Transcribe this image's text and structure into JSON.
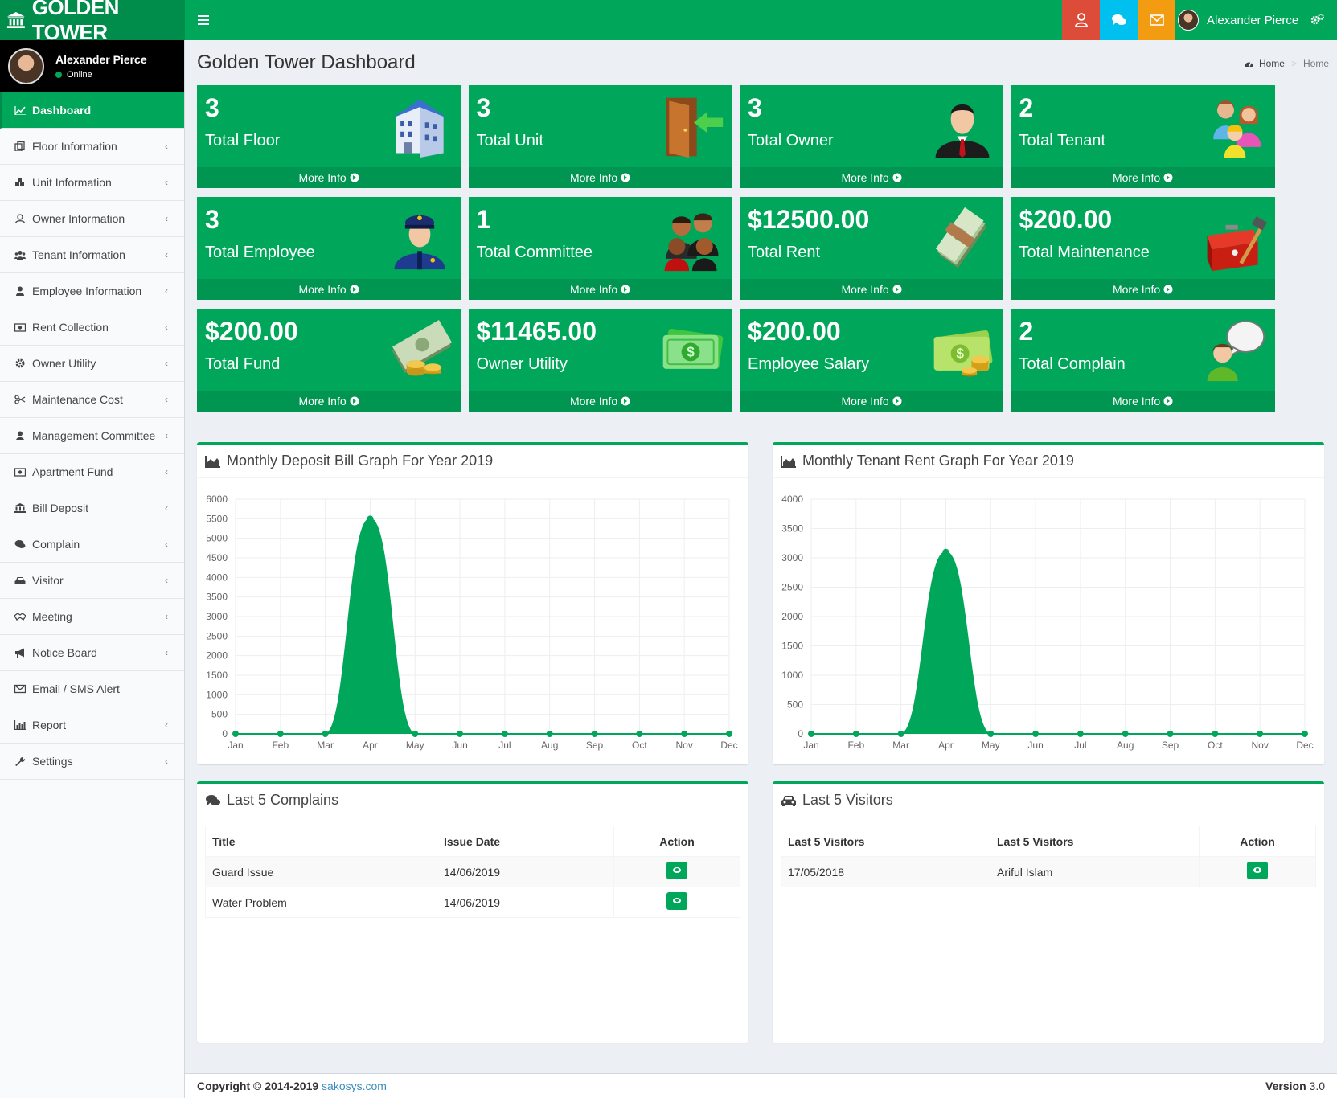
{
  "app": {
    "logo_text": "GOLDEN TOWER"
  },
  "header": {
    "user_name": "Alexander Pierce",
    "colors": {
      "alert": "#dd4b39",
      "chat": "#00c0ef",
      "mail": "#f39c12"
    }
  },
  "sidebar": {
    "user": {
      "name": "Alexander Pierce",
      "status": "Online"
    },
    "items": [
      {
        "label": "Dashboard",
        "icon": "line-chart-icon"
      },
      {
        "label": "Floor Information",
        "icon": "copy-icon"
      },
      {
        "label": "Unit Information",
        "icon": "cubes-icon"
      },
      {
        "label": "Owner Information",
        "icon": "user-outline-icon"
      },
      {
        "label": "Tenant Information",
        "icon": "users-icon"
      },
      {
        "label": "Employee Information",
        "icon": "user-icon"
      },
      {
        "label": "Rent Collection",
        "icon": "money-icon"
      },
      {
        "label": "Owner Utility",
        "icon": "gear-icon"
      },
      {
        "label": "Maintenance Cost",
        "icon": "scissors-icon"
      },
      {
        "label": "Management Committee",
        "icon": "user-icon"
      },
      {
        "label": "Apartment Fund",
        "icon": "money-icon"
      },
      {
        "label": "Bill Deposit",
        "icon": "bank-icon"
      },
      {
        "label": "Complain",
        "icon": "comments-icon"
      },
      {
        "label": "Visitor",
        "icon": "car-icon"
      },
      {
        "label": "Meeting",
        "icon": "handshake-icon"
      },
      {
        "label": "Notice Board",
        "icon": "bullhorn-icon"
      },
      {
        "label": "Email / SMS Alert",
        "icon": "envelope-icon"
      },
      {
        "label": "Report",
        "icon": "bar-chart-icon"
      },
      {
        "label": "Settings",
        "icon": "wrench-icon"
      }
    ]
  },
  "page": {
    "title": "Golden Tower Dashboard",
    "breadcrumb": {
      "home": "Home",
      "current": "Home"
    }
  },
  "boxes": [
    {
      "value": "3",
      "label": "Total Floor",
      "more": "More Info",
      "icon": "building-icon"
    },
    {
      "value": "3",
      "label": "Total Unit",
      "more": "More Info",
      "icon": "door-icon"
    },
    {
      "value": "3",
      "label": "Total Owner",
      "more": "More Info",
      "icon": "businessman-icon"
    },
    {
      "value": "2",
      "label": "Total Tenant",
      "more": "More Info",
      "icon": "family-icon"
    },
    {
      "value": "3",
      "label": "Total Employee",
      "more": "More Info",
      "icon": "officer-icon"
    },
    {
      "value": "1",
      "label": "Total Committee",
      "more": "More Info",
      "icon": "group-icon"
    },
    {
      "value": "$12500.00",
      "label": "Total Rent",
      "more": "More Info",
      "icon": "cash-stack-icon"
    },
    {
      "value": "$200.00",
      "label": "Total Maintenance",
      "more": "More Info",
      "icon": "toolbox-icon"
    },
    {
      "value": "$200.00",
      "label": "Total Fund",
      "more": "More Info",
      "icon": "cash-coins-icon"
    },
    {
      "value": "$11465.00",
      "label": "Owner Utility",
      "more": "More Info",
      "icon": "banknote-icon"
    },
    {
      "value": "$200.00",
      "label": "Employee Salary",
      "more": "More Info",
      "icon": "banknote-coins-icon"
    },
    {
      "value": "2",
      "label": "Total Complain",
      "more": "More Info",
      "icon": "speech-person-icon"
    }
  ],
  "chart_data": [
    {
      "type": "area",
      "title": "Monthly Deposit Bill Graph For Year 2019",
      "categories": [
        "Jan",
        "Feb",
        "Mar",
        "Apr",
        "May",
        "Jun",
        "Jul",
        "Aug",
        "Sep",
        "Oct",
        "Nov",
        "Dec"
      ],
      "values": [
        0,
        0,
        0,
        5500,
        0,
        0,
        0,
        0,
        0,
        0,
        0,
        0
      ],
      "ylim": [
        0,
        6000
      ],
      "yticks": [
        0,
        500,
        1000,
        1500,
        2000,
        2500,
        3000,
        3500,
        4000,
        4500,
        5000,
        5500,
        6000
      ],
      "grid": true,
      "color": "#00a65a"
    },
    {
      "type": "area",
      "title": "Monthly Tenant Rent Graph For Year 2019",
      "categories": [
        "Jan",
        "Feb",
        "Mar",
        "Apr",
        "May",
        "Jun",
        "Jul",
        "Aug",
        "Sep",
        "Oct",
        "Nov",
        "Dec"
      ],
      "values": [
        0,
        0,
        0,
        3100,
        0,
        0,
        0,
        0,
        0,
        0,
        0,
        0
      ],
      "ylim": [
        0,
        4000
      ],
      "yticks": [
        0,
        500,
        1000,
        1500,
        2000,
        2500,
        3000,
        3500,
        4000
      ],
      "grid": true,
      "color": "#00a65a"
    }
  ],
  "complains": {
    "title": "Last 5 Complains",
    "headers": [
      "Title",
      "Issue Date",
      "Action"
    ],
    "rows": [
      {
        "title": "Guard Issue",
        "date": "14/06/2019"
      },
      {
        "title": "Water Problem",
        "date": "14/06/2019"
      }
    ]
  },
  "visitors": {
    "title": "Last 5 Visitors",
    "headers": [
      "Last 5 Visitors",
      "Last 5 Visitors",
      "Action"
    ],
    "rows": [
      {
        "date": "17/05/2018",
        "name": "Ariful Islam"
      }
    ]
  },
  "footer": {
    "copyright": "Copyright © 2014-2019",
    "link": "sakosys.com",
    "version_label": "Version",
    "version": "3.0"
  }
}
